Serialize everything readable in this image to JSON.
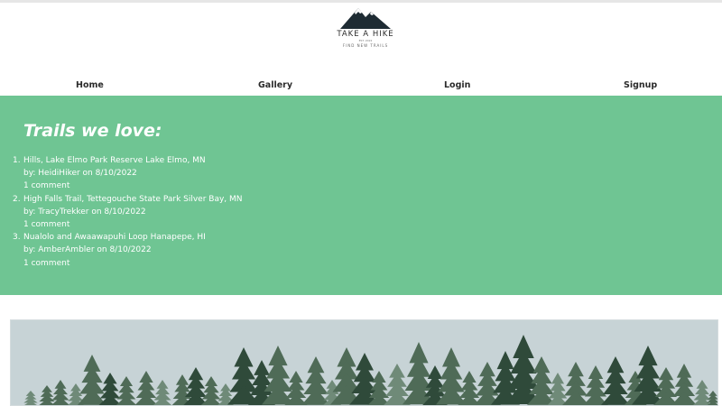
{
  "logo": {
    "title": "TAKE A HIKE",
    "small_mark": "EST. 2022",
    "tagline": "FIND NEW TRAILS"
  },
  "nav": {
    "items": [
      {
        "label": "Home"
      },
      {
        "label": "Gallery"
      },
      {
        "label": "Login"
      },
      {
        "label": "Signup"
      }
    ]
  },
  "hero": {
    "heading": "Trails we love:",
    "trails": [
      {
        "number": "1.",
        "name": "Hills, Lake Elmo Park Reserve Lake Elmo, MN",
        "byline": "by: HeidiHiker on 8/10/2022",
        "comments": "1 comment"
      },
      {
        "number": "2.",
        "name": "High Falls Trail, Tettegouche State Park Silver Bay, MN",
        "byline": "by: TracyTrekker on 8/10/2022",
        "comments": "1 comment"
      },
      {
        "number": "3.",
        "name": "Nualolo and Awaawapuhi Loop Hanapepe, HI",
        "byline": "by: AmberAmbler on 8/10/2022",
        "comments": "1 comment"
      }
    ]
  },
  "colors": {
    "hero_bg": "#6fc593",
    "panel_bg": "#c7d3d6",
    "tree_dark": "#2f4a3a",
    "tree_mid": "#4f6b57",
    "tree_light": "#6f8a78"
  },
  "panel": {
    "image_subject": "forest-treeline-image"
  }
}
